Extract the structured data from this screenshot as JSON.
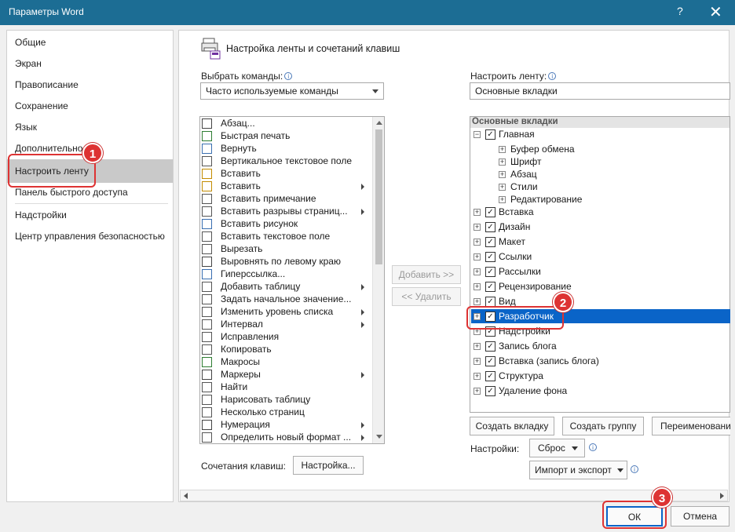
{
  "window": {
    "title": "Параметры Word",
    "help": "?",
    "close": "✕"
  },
  "nav": {
    "items": [
      "Общие",
      "Экран",
      "Правописание",
      "Сохранение",
      "Язык",
      "Дополнительно",
      "Настроить ленту",
      "Панель быстрого доступа",
      "Надстройки",
      "Центр управления безопасностью"
    ],
    "selected": "Настроить ленту"
  },
  "main": {
    "heading": "Настройка ленты и сочетаний клавиш",
    "choose_label": "Выбрать команды:",
    "choose_value": "Часто используемые команды",
    "customize_label": "Настроить ленту:",
    "customize_value": "Основные вкладки",
    "commands": [
      {
        "label": "Абзац...",
        "icon": "paragraph-icon",
        "sub": false
      },
      {
        "label": "Быстрая печать",
        "icon": "quick-print-icon",
        "sub": false
      },
      {
        "label": "Вернуть",
        "icon": "redo-icon",
        "sub": false
      },
      {
        "label": "Вертикальное текстовое поле",
        "icon": "vertical-textbox-icon",
        "sub": false
      },
      {
        "label": "Вставить",
        "icon": "paste-icon",
        "sub": false
      },
      {
        "label": "Вставить",
        "icon": "paste-options-icon",
        "sub": true
      },
      {
        "label": "Вставить примечание",
        "icon": "comment-icon",
        "sub": false
      },
      {
        "label": "Вставить разрывы страниц...",
        "icon": "page-break-icon",
        "sub": true
      },
      {
        "label": "Вставить рисунок",
        "icon": "picture-icon",
        "sub": false
      },
      {
        "label": "Вставить текстовое поле",
        "icon": "textbox-icon",
        "sub": false
      },
      {
        "label": "Вырезать",
        "icon": "cut-icon",
        "sub": false
      },
      {
        "label": "Выровнять по левому краю",
        "icon": "align-left-icon",
        "sub": false
      },
      {
        "label": "Гиперссылка...",
        "icon": "hyperlink-icon",
        "sub": false
      },
      {
        "label": "Добавить таблицу",
        "icon": "table-icon",
        "sub": true
      },
      {
        "label": "Задать начальное значение...",
        "icon": "numbering-value-icon",
        "sub": false
      },
      {
        "label": "Изменить уровень списка",
        "icon": "list-level-icon",
        "sub": true
      },
      {
        "label": "Интервал",
        "icon": "spacing-icon",
        "sub": true
      },
      {
        "label": "Исправления",
        "icon": "track-changes-icon",
        "sub": false
      },
      {
        "label": "Копировать",
        "icon": "copy-icon",
        "sub": false
      },
      {
        "label": "Макросы",
        "icon": "macros-icon",
        "sub": false
      },
      {
        "label": "Маркеры",
        "icon": "bullets-icon",
        "sub": true
      },
      {
        "label": "Найти",
        "icon": "find-icon",
        "sub": false
      },
      {
        "label": "Нарисовать таблицу",
        "icon": "draw-table-icon",
        "sub": false
      },
      {
        "label": "Несколько страниц",
        "icon": "multiple-pages-icon",
        "sub": false
      },
      {
        "label": "Нумерация",
        "icon": "numbering-icon",
        "sub": true
      },
      {
        "label": "Определить новый формат ...",
        "icon": "define-format-icon",
        "sub": true
      }
    ],
    "add_label": "Добавить >>",
    "remove_label": "<< Удалить",
    "tree_header": "Основные вкладки",
    "tree": [
      {
        "label": "Главная",
        "level": 0,
        "expander": "⊟",
        "checkbox": true
      },
      {
        "label": "Буфер обмена",
        "level": 1,
        "expander": "⊞",
        "checkbox": false
      },
      {
        "label": "Шрифт",
        "level": 1,
        "expander": "⊞",
        "checkbox": false
      },
      {
        "label": "Абзац",
        "level": 1,
        "expander": "⊞",
        "checkbox": false
      },
      {
        "label": "Стили",
        "level": 1,
        "expander": "⊞",
        "checkbox": false
      },
      {
        "label": "Редактирование",
        "level": 1,
        "expander": "⊞",
        "checkbox": false
      },
      {
        "label": "Вставка",
        "level": 0,
        "expander": "⊞",
        "checkbox": true
      },
      {
        "label": "Дизайн",
        "level": 0,
        "expander": "⊞",
        "checkbox": true
      },
      {
        "label": "Макет",
        "level": 0,
        "expander": "⊞",
        "checkbox": true
      },
      {
        "label": "Ссылки",
        "level": 0,
        "expander": "⊞",
        "checkbox": true
      },
      {
        "label": "Рассылки",
        "level": 0,
        "expander": "⊞",
        "checkbox": true
      },
      {
        "label": "Рецензирование",
        "level": 0,
        "expander": "⊞",
        "checkbox": true
      },
      {
        "label": "Вид",
        "level": 0,
        "expander": "⊞",
        "checkbox": true
      },
      {
        "label": "Разработчик",
        "level": 0,
        "expander": "⊞",
        "checkbox": true
      },
      {
        "label": "Надстройки",
        "level": 0,
        "expander": "⊞",
        "checkbox": true
      },
      {
        "label": "Запись блога",
        "level": 0,
        "expander": "⊞",
        "checkbox": true
      },
      {
        "label": "Вставка (запись блога)",
        "level": 0,
        "expander": "⊞",
        "checkbox": true
      },
      {
        "label": "Структура",
        "level": 0,
        "expander": "⊞",
        "checkbox": true
      },
      {
        "label": "Удаление фона",
        "level": 0,
        "expander": "⊞",
        "checkbox": true
      }
    ],
    "selected_tab": "Разработчик",
    "new_tab_label": "Создать вкладку",
    "new_group_label": "Создать группу",
    "rename_label": "Переименовани",
    "settings_label": "Настройки:",
    "reset_label": "Сброс",
    "import_export_label": "Импорт и экспорт",
    "shortcuts_label": "Сочетания клавиш:",
    "customize_button_label": "Настройка..."
  },
  "footer": {
    "ok_label": "ОК",
    "cancel_label": "Отмена"
  },
  "callouts": [
    "1",
    "2",
    "3"
  ],
  "colors": {
    "titlebar": "#1c6d94",
    "selection": "#0a64c8",
    "callout": "#dd3333"
  }
}
